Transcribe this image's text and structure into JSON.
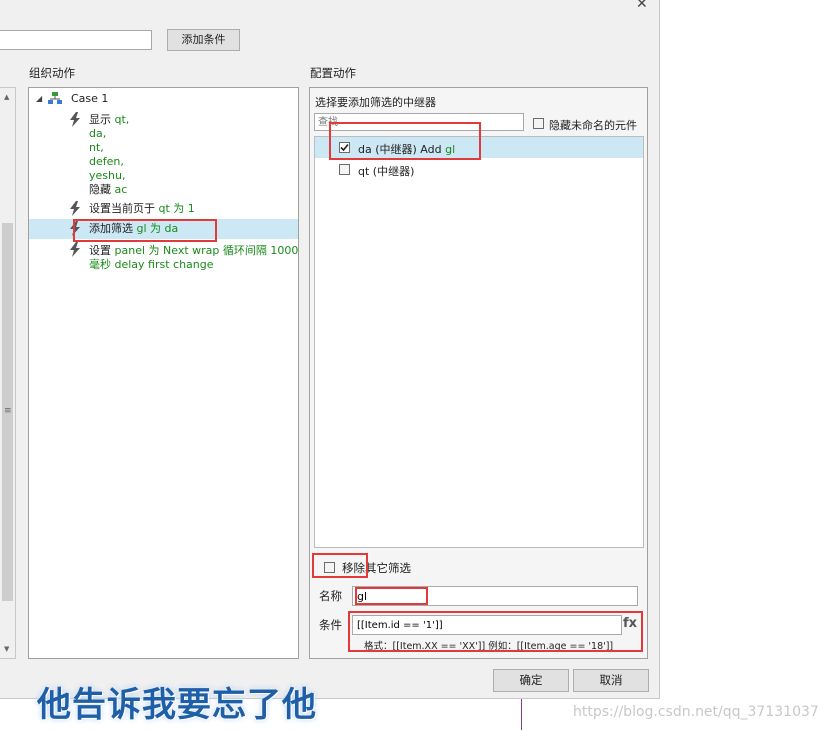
{
  "dialog": {
    "close_glyph": "✕",
    "add_condition_label": "添加条件",
    "organize_label": "组织动作",
    "configure_label": "配置动作",
    "ok_label": "确定",
    "cancel_label": "取消"
  },
  "case_tree": {
    "case_name": "Case 1",
    "actions": [
      {
        "verb": "显示",
        "lines": [
          "qt,",
          "da,",
          "nt,",
          "defen,",
          "yeshu,"
        ],
        "tail_verb": "隐藏",
        "tail_value": "ac"
      },
      {
        "verb": "设置当前页于",
        "value": "qt 为 1"
      },
      {
        "verb": "添加筛选",
        "value": "gl 为 da",
        "selected": true
      },
      {
        "verb": "设置",
        "value_line1": "panel 为 Next wrap 循环间隔 1000",
        "value_line2": "毫秒 delay first change"
      }
    ]
  },
  "config": {
    "select_repeater_label": "选择要添加筛选的中继器",
    "search_placeholder": "查找",
    "hide_unnamed_label": "隐藏未命名的元件",
    "repeaters": [
      {
        "name": "da (中继器) Add ",
        "suffix": "gl",
        "checked": true,
        "selected": true
      },
      {
        "name": "qt (中继器)",
        "suffix": "",
        "checked": false,
        "selected": false
      }
    ],
    "remove_other_filters_label": "移除其它筛选",
    "name_label": "名称",
    "name_value": "gl",
    "condition_label": "条件",
    "condition_value": "[[Item.id == '1']]",
    "fx_label": "fx",
    "format_hint": "格式：[[Item.XX == 'XX']] 例如：[[Item.age == '18']]"
  },
  "overlay": {
    "caption": "他告诉我要忘了他",
    "watermark": "https://blog.csdn.net/qq_37131037"
  },
  "colors": {
    "accent_red": "#e23a3a",
    "selected_row": "#cce8f4",
    "value_green": "#1a8a1a",
    "caption_blue": "#1f5fa8"
  }
}
